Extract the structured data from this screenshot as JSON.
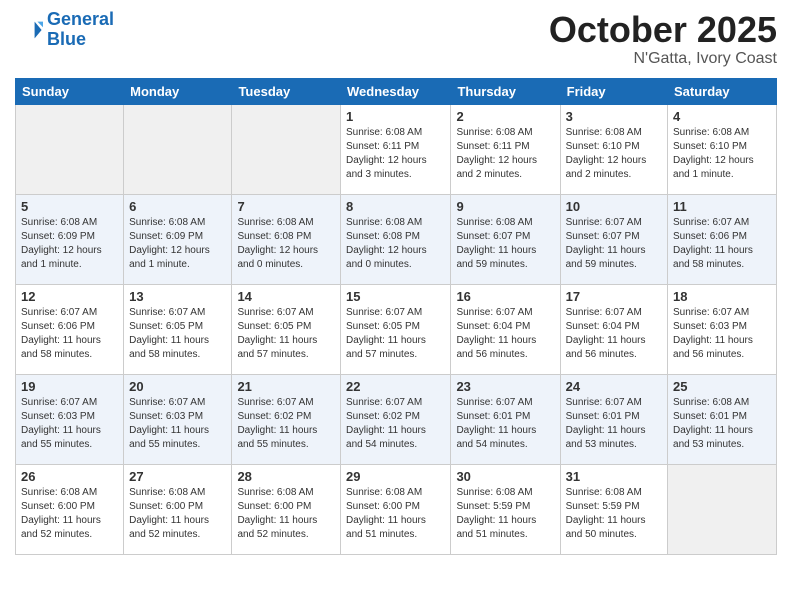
{
  "logo": {
    "line1": "General",
    "line2": "Blue"
  },
  "title": "October 2025",
  "location": "N'Gatta, Ivory Coast",
  "days_of_week": [
    "Sunday",
    "Monday",
    "Tuesday",
    "Wednesday",
    "Thursday",
    "Friday",
    "Saturday"
  ],
  "weeks": [
    [
      {
        "day": "",
        "info": ""
      },
      {
        "day": "",
        "info": ""
      },
      {
        "day": "",
        "info": ""
      },
      {
        "day": "1",
        "info": "Sunrise: 6:08 AM\nSunset: 6:11 PM\nDaylight: 12 hours\nand 3 minutes."
      },
      {
        "day": "2",
        "info": "Sunrise: 6:08 AM\nSunset: 6:11 PM\nDaylight: 12 hours\nand 2 minutes."
      },
      {
        "day": "3",
        "info": "Sunrise: 6:08 AM\nSunset: 6:10 PM\nDaylight: 12 hours\nand 2 minutes."
      },
      {
        "day": "4",
        "info": "Sunrise: 6:08 AM\nSunset: 6:10 PM\nDaylight: 12 hours\nand 1 minute."
      }
    ],
    [
      {
        "day": "5",
        "info": "Sunrise: 6:08 AM\nSunset: 6:09 PM\nDaylight: 12 hours\nand 1 minute."
      },
      {
        "day": "6",
        "info": "Sunrise: 6:08 AM\nSunset: 6:09 PM\nDaylight: 12 hours\nand 1 minute."
      },
      {
        "day": "7",
        "info": "Sunrise: 6:08 AM\nSunset: 6:08 PM\nDaylight: 12 hours\nand 0 minutes."
      },
      {
        "day": "8",
        "info": "Sunrise: 6:08 AM\nSunset: 6:08 PM\nDaylight: 12 hours\nand 0 minutes."
      },
      {
        "day": "9",
        "info": "Sunrise: 6:08 AM\nSunset: 6:07 PM\nDaylight: 11 hours\nand 59 minutes."
      },
      {
        "day": "10",
        "info": "Sunrise: 6:07 AM\nSunset: 6:07 PM\nDaylight: 11 hours\nand 59 minutes."
      },
      {
        "day": "11",
        "info": "Sunrise: 6:07 AM\nSunset: 6:06 PM\nDaylight: 11 hours\nand 58 minutes."
      }
    ],
    [
      {
        "day": "12",
        "info": "Sunrise: 6:07 AM\nSunset: 6:06 PM\nDaylight: 11 hours\nand 58 minutes."
      },
      {
        "day": "13",
        "info": "Sunrise: 6:07 AM\nSunset: 6:05 PM\nDaylight: 11 hours\nand 58 minutes."
      },
      {
        "day": "14",
        "info": "Sunrise: 6:07 AM\nSunset: 6:05 PM\nDaylight: 11 hours\nand 57 minutes."
      },
      {
        "day": "15",
        "info": "Sunrise: 6:07 AM\nSunset: 6:05 PM\nDaylight: 11 hours\nand 57 minutes."
      },
      {
        "day": "16",
        "info": "Sunrise: 6:07 AM\nSunset: 6:04 PM\nDaylight: 11 hours\nand 56 minutes."
      },
      {
        "day": "17",
        "info": "Sunrise: 6:07 AM\nSunset: 6:04 PM\nDaylight: 11 hours\nand 56 minutes."
      },
      {
        "day": "18",
        "info": "Sunrise: 6:07 AM\nSunset: 6:03 PM\nDaylight: 11 hours\nand 56 minutes."
      }
    ],
    [
      {
        "day": "19",
        "info": "Sunrise: 6:07 AM\nSunset: 6:03 PM\nDaylight: 11 hours\nand 55 minutes."
      },
      {
        "day": "20",
        "info": "Sunrise: 6:07 AM\nSunset: 6:03 PM\nDaylight: 11 hours\nand 55 minutes."
      },
      {
        "day": "21",
        "info": "Sunrise: 6:07 AM\nSunset: 6:02 PM\nDaylight: 11 hours\nand 55 minutes."
      },
      {
        "day": "22",
        "info": "Sunrise: 6:07 AM\nSunset: 6:02 PM\nDaylight: 11 hours\nand 54 minutes."
      },
      {
        "day": "23",
        "info": "Sunrise: 6:07 AM\nSunset: 6:01 PM\nDaylight: 11 hours\nand 54 minutes."
      },
      {
        "day": "24",
        "info": "Sunrise: 6:07 AM\nSunset: 6:01 PM\nDaylight: 11 hours\nand 53 minutes."
      },
      {
        "day": "25",
        "info": "Sunrise: 6:08 AM\nSunset: 6:01 PM\nDaylight: 11 hours\nand 53 minutes."
      }
    ],
    [
      {
        "day": "26",
        "info": "Sunrise: 6:08 AM\nSunset: 6:00 PM\nDaylight: 11 hours\nand 52 minutes."
      },
      {
        "day": "27",
        "info": "Sunrise: 6:08 AM\nSunset: 6:00 PM\nDaylight: 11 hours\nand 52 minutes."
      },
      {
        "day": "28",
        "info": "Sunrise: 6:08 AM\nSunset: 6:00 PM\nDaylight: 11 hours\nand 52 minutes."
      },
      {
        "day": "29",
        "info": "Sunrise: 6:08 AM\nSunset: 6:00 PM\nDaylight: 11 hours\nand 51 minutes."
      },
      {
        "day": "30",
        "info": "Sunrise: 6:08 AM\nSunset: 5:59 PM\nDaylight: 11 hours\nand 51 minutes."
      },
      {
        "day": "31",
        "info": "Sunrise: 6:08 AM\nSunset: 5:59 PM\nDaylight: 11 hours\nand 50 minutes."
      },
      {
        "day": "",
        "info": ""
      }
    ]
  ]
}
